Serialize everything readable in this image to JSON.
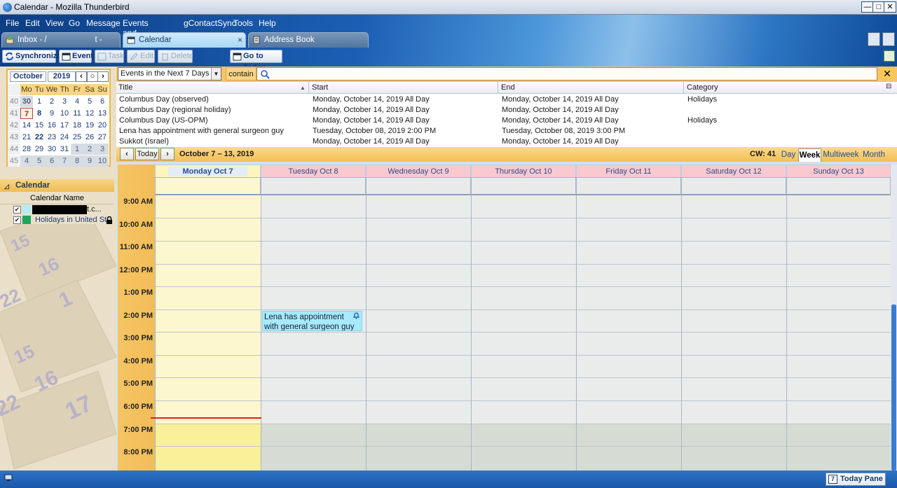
{
  "window": {
    "title": "Calendar - Mozilla Thunderbird",
    "minimize": "—",
    "maximize": "□",
    "close": "✕"
  },
  "menu": [
    "File",
    "Edit",
    "View",
    "Go",
    "Message",
    "Events and Tasks",
    "gContactSync",
    "Tools",
    "Help"
  ],
  "tabs": [
    {
      "label": "Inbox - /      t - Gmail"
    },
    {
      "label": "Calendar"
    },
    {
      "label": "Address Book"
    }
  ],
  "toolbar": {
    "synchronize": "Synchronize",
    "event": "Event",
    "task": "Task",
    "edit": "Edit",
    "delete": "Delete",
    "go_today": "Go to Today"
  },
  "minimonth": {
    "month": "October",
    "year": "2019",
    "days": [
      "Mo",
      "Tu",
      "We",
      "Th",
      "Fr",
      "Sa",
      "Su"
    ],
    "weeks": [
      {
        "wk": "40",
        "d": [
          "30",
          "1",
          "2",
          "3",
          "4",
          "5",
          "6"
        ]
      },
      {
        "wk": "41",
        "d": [
          "7",
          "8",
          "9",
          "10",
          "11",
          "12",
          "13"
        ]
      },
      {
        "wk": "42",
        "d": [
          "14",
          "15",
          "16",
          "17",
          "18",
          "19",
          "20"
        ]
      },
      {
        "wk": "43",
        "d": [
          "21",
          "22",
          "23",
          "24",
          "25",
          "26",
          "27"
        ]
      },
      {
        "wk": "44",
        "d": [
          "28",
          "29",
          "30",
          "31",
          "1",
          "2",
          "3"
        ]
      },
      {
        "wk": "45",
        "d": [
          "4",
          "5",
          "6",
          "7",
          "8",
          "9",
          "10"
        ]
      }
    ]
  },
  "calendars": {
    "header": "Calendar",
    "colname": "Calendar Name",
    "items": [
      {
        "name": "t.c...",
        "color": "#b2ecfa"
      },
      {
        "name": "Holidays in United St...",
        "color": "#1ea55b"
      }
    ]
  },
  "filter": {
    "selected": "Events in the Next 7 Days",
    "contain": "contain",
    "search": ""
  },
  "list": {
    "columns": [
      "Title",
      "Start",
      "End",
      "Category"
    ],
    "rows": [
      [
        "Columbus Day (observed)",
        "Monday, October 14, 2019 All Day",
        "Monday, October 14, 2019 All Day",
        "Holidays"
      ],
      [
        "Columbus Day (regional holiday)",
        "Monday, October 14, 2019 All Day",
        "Monday, October 14, 2019 All Day",
        ""
      ],
      [
        "Columbus Day (US-OPM)",
        "Monday, October 14, 2019 All Day",
        "Monday, October 14, 2019 All Day",
        "Holidays"
      ],
      [
        "Lena has appointment with general surgeon guy",
        "Tuesday, October 08, 2019 2:00 PM",
        "Tuesday, October 08, 2019 3:00 PM",
        ""
      ],
      [
        "Sukkot (Israel)",
        "Monday, October 14, 2019 All Day",
        "Monday, October 14, 2019 All Day",
        ""
      ]
    ]
  },
  "nav": {
    "today": "Today",
    "range": "October 7 – 13, 2019",
    "cw": "CW: 41",
    "views": [
      "Day",
      "Week",
      "Multiweek",
      "Month"
    ]
  },
  "week": {
    "days": [
      "Monday Oct 7",
      "Tuesday Oct 8",
      "Wednesday Oct 9",
      "Thursday Oct 10",
      "Friday Oct 11",
      "Saturday Oct 12",
      "Sunday Oct 13"
    ],
    "hours": [
      "9:00 AM",
      "10:00 AM",
      "11:00 AM",
      "12:00 PM",
      "1:00 PM",
      "2:00 PM",
      "3:00 PM",
      "4:00 PM",
      "5:00 PM",
      "6:00 PM",
      "7:00 PM",
      "8:00 PM"
    ]
  },
  "event": {
    "title": "Lena has appointment with general surgeon guy"
  },
  "status": {
    "todaypane": "Today Pane ⌃",
    "todaypane_day": "7"
  }
}
